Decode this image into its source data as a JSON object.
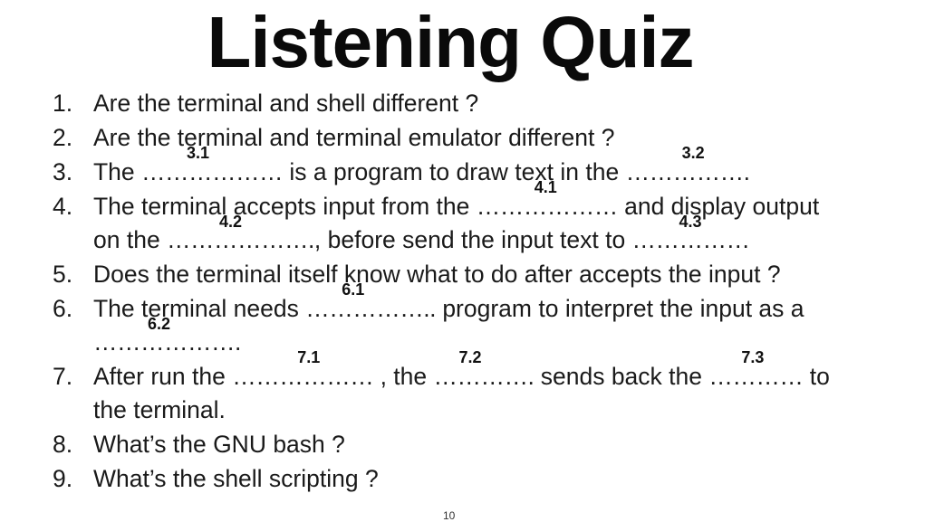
{
  "slide": {
    "title": "Listening Quiz",
    "page_number": "10"
  },
  "questions": [
    {
      "number": "1.",
      "line1": "Are the terminal and shell different ?"
    },
    {
      "number": "2.",
      "line1": "Are the terminal and terminal emulator different ?"
    },
    {
      "number": "3.",
      "t1": "The ",
      "b1": {
        "dots": "………………",
        "label": "3.1"
      },
      "t2": " is a program to draw text in the ",
      "b2": {
        "dots": "…………….",
        "label": "3.2"
      }
    },
    {
      "number": "4.",
      "t1": "The terminal accepts input from the ",
      "b1": {
        "dots": "………………",
        "label": "4.1"
      },
      "t2": " and display output",
      "t3": "on the ",
      "b2": {
        "dots": "……………….",
        "label": "4.2"
      },
      "t4": ", before send the input text to ",
      "b3": {
        "dots": "……………",
        "label": "4.3"
      }
    },
    {
      "number": "5.",
      "line1": "Does the terminal itself know what to do after accepts the input ?"
    },
    {
      "number": "6.",
      "t1": "The terminal needs ",
      "b1": {
        "dots": "……………..",
        "label": "6.1"
      },
      "t2": " program to interpret the input as a",
      "b2": {
        "dots": "……………….",
        "label": "6.2"
      }
    },
    {
      "number": "7.",
      "t1": "After run the ",
      "b1": {
        "dots": "………………",
        "label": "7.1"
      },
      "t2": " , the ",
      "b2": {
        "dots": "………….",
        "label": "7.2"
      },
      "t3": " sends back the ",
      "b3": {
        "dots": "…………",
        "label": "7.3"
      },
      "t4": " to",
      "t5": "the terminal."
    },
    {
      "number": "8.",
      "line1": "What’s the GNU bash ?"
    },
    {
      "number": "9.",
      "line1": "What’s the shell scripting ?"
    }
  ]
}
